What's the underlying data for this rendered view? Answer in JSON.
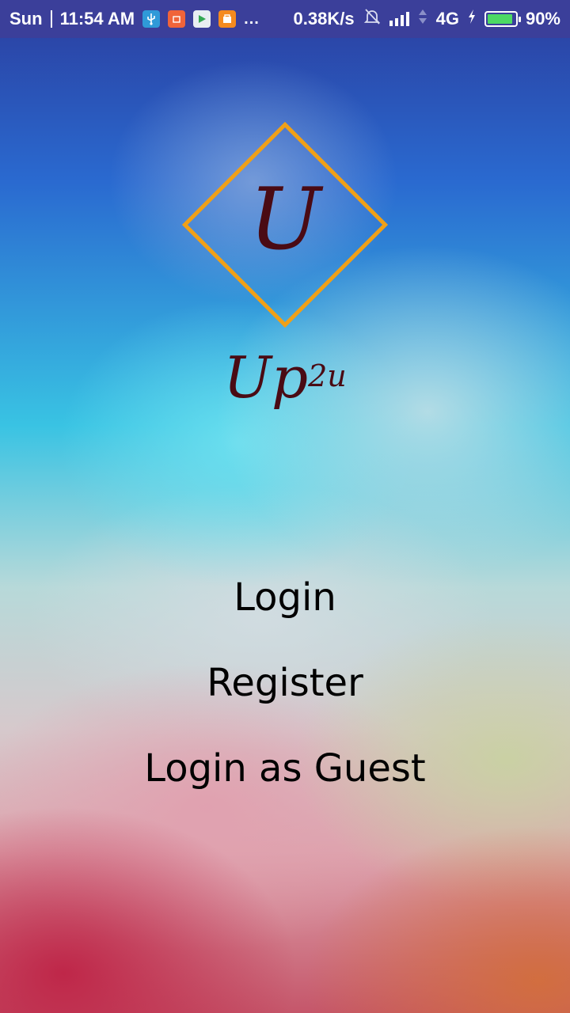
{
  "status_bar": {
    "day": "Sun",
    "time": "11:54 AM",
    "more": "...",
    "net_speed": "0.38K/s",
    "network": "4G",
    "battery_percent": "90%",
    "battery_level": 0.9,
    "notification_icons": [
      "usb-icon",
      "mi-icon",
      "play-store-icon",
      "shop-icon"
    ],
    "battery_color": "#4cd964"
  },
  "logo": {
    "letter": "U",
    "brand_main": "Up",
    "brand_sup": "2u",
    "diamond_color": "#f0a017",
    "text_color": "#4a0b14"
  },
  "menu": {
    "login": "Login",
    "register": "Register",
    "guest": "Login as Guest"
  }
}
